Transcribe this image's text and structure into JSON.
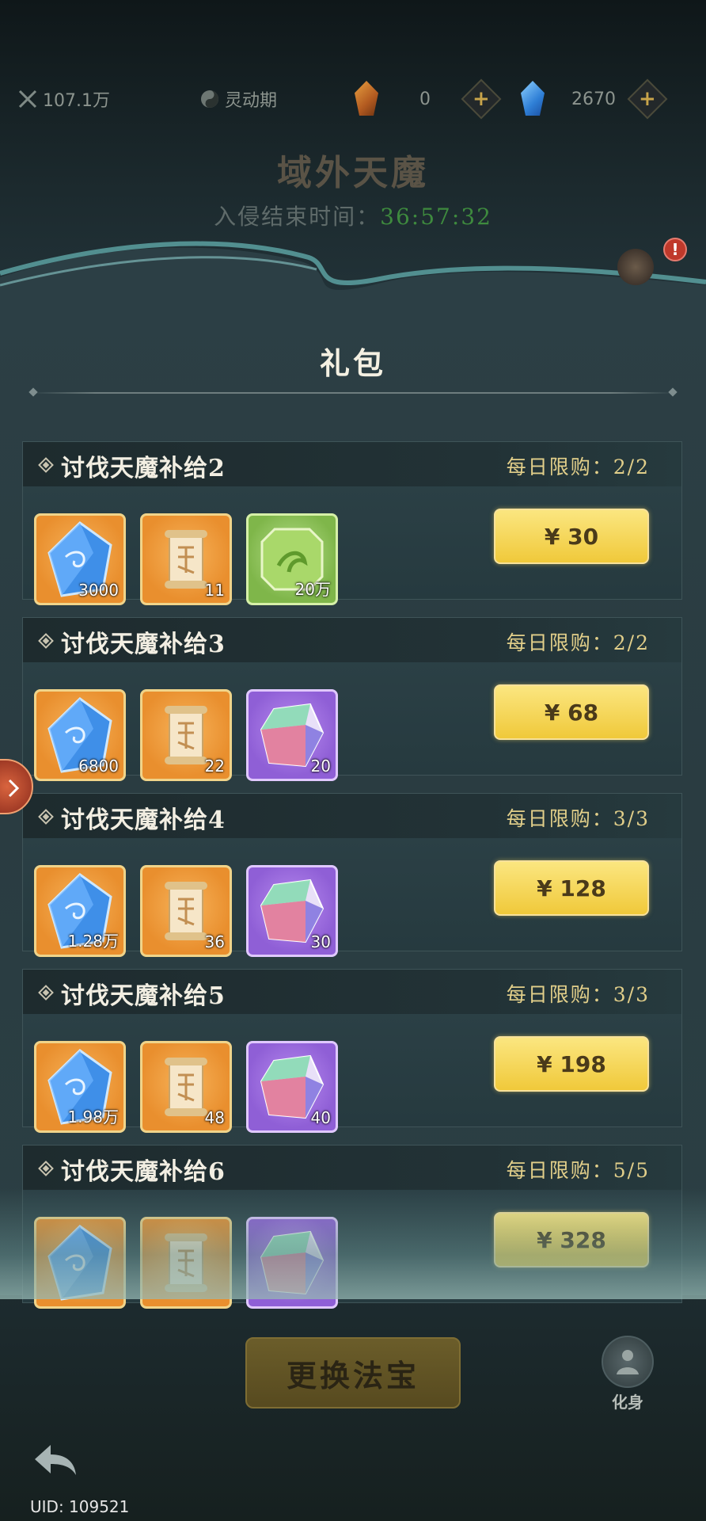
{
  "topbar": {
    "power": "107.1万",
    "realm": "灵动期",
    "currency1_value": "0",
    "currency2_value": "2670",
    "plus_label": "+"
  },
  "header": {
    "event_title": "域外天魔",
    "timer_label": "入侵结束时间：",
    "timer_value": "36:57:32",
    "alert_count": "!"
  },
  "panel": {
    "title": "礼包"
  },
  "packs": [
    {
      "name": "讨伐天魔补给2",
      "limit": "每日限购：2/2",
      "price": "¥ 30",
      "items": [
        {
          "icon": "blue-crystal-icon",
          "count": "3000"
        },
        {
          "icon": "scroll-icon",
          "count": "11"
        },
        {
          "icon": "jade-token-icon",
          "count": "20万"
        }
      ]
    },
    {
      "name": "讨伐天魔补给3",
      "limit": "每日限购：2/2",
      "price": "¥ 68",
      "items": [
        {
          "icon": "blue-crystal-icon",
          "count": "6800"
        },
        {
          "icon": "scroll-icon",
          "count": "22"
        },
        {
          "icon": "rainbow-gem-icon",
          "count": "20"
        }
      ]
    },
    {
      "name": "讨伐天魔补给4",
      "limit": "每日限购：3/3",
      "price": "¥ 128",
      "items": [
        {
          "icon": "blue-crystal-icon",
          "count": "1.28万"
        },
        {
          "icon": "scroll-icon",
          "count": "36"
        },
        {
          "icon": "rainbow-gem-icon",
          "count": "30"
        }
      ]
    },
    {
      "name": "讨伐天魔补给5",
      "limit": "每日限购：3/3",
      "price": "¥ 198",
      "items": [
        {
          "icon": "blue-crystal-icon",
          "count": "1.98万"
        },
        {
          "icon": "scroll-icon",
          "count": "48"
        },
        {
          "icon": "rainbow-gem-icon",
          "count": "40"
        }
      ]
    },
    {
      "name": "讨伐天魔补给6",
      "limit": "每日限购：5/5",
      "price": "¥ 328",
      "items": [
        {
          "icon": "blue-crystal-icon",
          "count": ""
        },
        {
          "icon": "scroll-icon",
          "count": ""
        },
        {
          "icon": "rainbow-gem-icon",
          "count": ""
        }
      ]
    }
  ],
  "bottom": {
    "action_label": "更换法宝",
    "avatar_label": "化身",
    "uid": "UID: 109521"
  },
  "colors": {
    "accent_gold": "#f0c93a",
    "timer_green": "#3e8a3e",
    "limit_gold": "#e2cf8a"
  }
}
